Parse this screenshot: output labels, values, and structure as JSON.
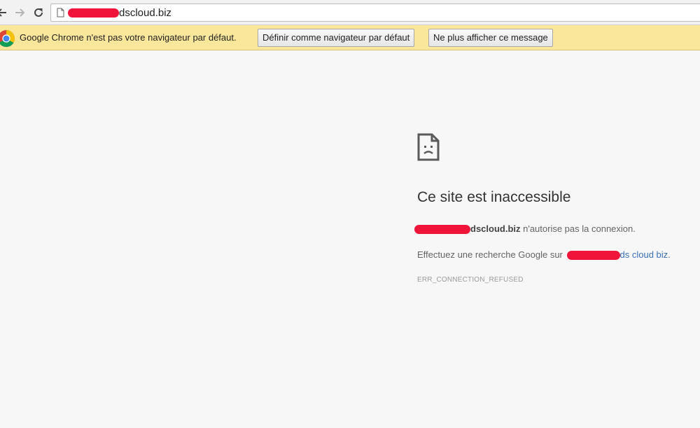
{
  "toolbar": {
    "url_text": "dscloud.biz",
    "icons": [
      "back-arrow-icon",
      "forward-arrow-icon",
      "reload-icon",
      "page-icon"
    ]
  },
  "infobar": {
    "message": "Google Chrome n'est pas votre navigateur par défaut.",
    "set_default_label": "Définir comme navigateur par défaut",
    "dismiss_label": "Ne plus afficher ce message",
    "icon": "chrome-logo-icon"
  },
  "error": {
    "icon": "sad-page-icon",
    "title": "Ce site est inaccessible",
    "host": "dscloud.biz",
    "refused_text": " n'autorise pas la connexion.",
    "search_prefix": "Effectuez une recherche Google sur ",
    "search_link": "ds cloud biz",
    "search_suffix": ".",
    "error_code": "ERR_CONNECTION_REFUSED"
  },
  "colors": {
    "infobar_bg": "#fbe79b",
    "redaction": "#f0143a",
    "link": "#3b6fb7",
    "page_bg": "#f7f7f7"
  }
}
